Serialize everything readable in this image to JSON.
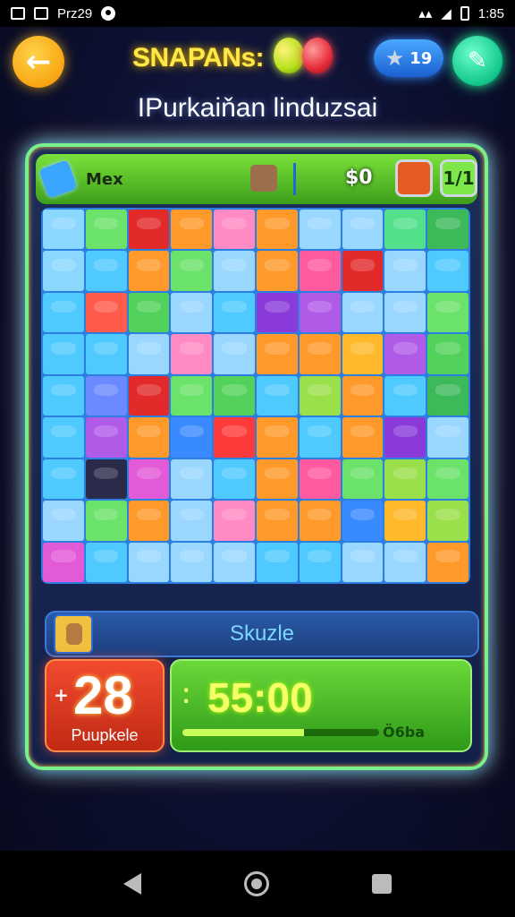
{
  "status_bar": {
    "carrier": "Prz29",
    "time": "1:85"
  },
  "header": {
    "back_icon": "arrow-left-icon",
    "title": "SNAPANs:",
    "coins": "19",
    "coin_icon": "star-icon",
    "tool_icon": "pencil-icon"
  },
  "subtitle": "IPurkaiňan linduzsai",
  "board_header": {
    "label": "Mex",
    "score": "$0",
    "count": "1/1"
  },
  "board": {
    "rows": 9,
    "cols": 10,
    "cells": [
      "#8ad7ff",
      "#6be26a",
      "#e22a2a",
      "#ff9a2a",
      "#ff8ac4",
      "#ff9a2a",
      "#9ad7ff",
      "#9ad7ff",
      "#52e08a",
      "#3cba5a",
      "#8ad7ff",
      "#4fcaff",
      "#ff9a2a",
      "#6be26a",
      "#9ad7ff",
      "#ff9a2a",
      "#ff5aa0",
      "#e22a2a",
      "#9ad7ff",
      "#4fcaff",
      "#4fcaff",
      "#ff5a4a",
      "#52d25a",
      "#9ad7ff",
      "#4fcaff",
      "#8a3ad8",
      "#b05ae8",
      "#9ad7ff",
      "#9ad7ff",
      "#6be26a",
      "#4fcaff",
      "#4fcaff",
      "#9ad7ff",
      "#ff8ac4",
      "#9ad7ff",
      "#ff9a2a",
      "#ff9a2a",
      "#ffb92a",
      "#b05ae8",
      "#52d25a",
      "#4fcaff",
      "#6b8aff",
      "#e22a2a",
      "#6be26a",
      "#52d25a",
      "#4fcaff",
      "#9ae04a",
      "#ff9a2a",
      "#4fcaff",
      "#3cba5a",
      "#4fcaff",
      "#b05ae8",
      "#ff9a2a",
      "#3a8aff",
      "#ff3a3a",
      "#ff9a2a",
      "#4fcaff",
      "#ff9a2a",
      "#8a3ad8",
      "#9ad7ff",
      "#4fcaff",
      "#2a2a4a",
      "#e25ad8",
      "#9ad7ff",
      "#4fcaff",
      "#ff9a2a",
      "#ff5aa0",
      "#6be26a",
      "#9ae04a",
      "#6be26a",
      "#9ad7ff",
      "#6be26a",
      "#ff9a2a",
      "#9ad7ff",
      "#ff8ac4",
      "#ff9a2a",
      "#ff9a2a",
      "#3a8aff",
      "#ffb92a",
      "#9ae04a",
      "#e25ad8",
      "#4fcaff",
      "#9ad7ff",
      "#9ad7ff",
      "#9ad7ff",
      "#4fcaff",
      "#4fcaff",
      "#9ad7ff",
      "#9ad7ff",
      "#ff9a2a"
    ]
  },
  "skill": {
    "label": "Skuzle"
  },
  "points": {
    "plus": "+",
    "value": "28",
    "label": "Puupkele"
  },
  "timer": {
    "value": "55:00",
    "sub": "Ö6ba",
    "progress": 0.62
  },
  "colors": {
    "accent_yellow": "#ffe94a",
    "accent_green": "#7bf08a",
    "accent_blue": "#4fd0ff"
  }
}
